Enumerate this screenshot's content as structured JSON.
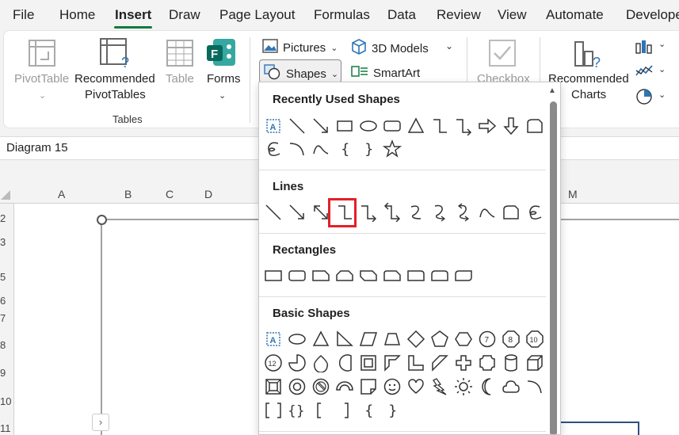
{
  "menu": {
    "tabs": [
      "File",
      "Home",
      "Insert",
      "Draw",
      "Page Layout",
      "Formulas",
      "Data",
      "Review",
      "View",
      "Automate",
      "Develope"
    ],
    "active_tab": "Insert"
  },
  "ribbon": {
    "pivot_table": "PivotTable",
    "recommended_pivot_1": "Recommended",
    "recommended_pivot_2": "PivotTables",
    "table": "Table",
    "forms": "Forms",
    "tables_group": "Tables",
    "pictures": "Pictures",
    "models_3d": "3D Models",
    "shapes": "Shapes",
    "smartart": "SmartArt",
    "checkbox": "Checkbox",
    "recommended_charts_1": "Recommended",
    "recommended_charts_2": "Charts"
  },
  "name_box": {
    "value": "Diagram 15"
  },
  "columns": [
    "A",
    "B",
    "C",
    "D",
    "M"
  ],
  "rows": [
    "2",
    "3",
    "5",
    "6",
    "7",
    "8",
    "9",
    "10",
    "11"
  ],
  "shapes_panel": {
    "sections": {
      "recent": "Recently Used Shapes",
      "lines": "Lines",
      "rectangles": "Rectangles",
      "basic": "Basic Shapes"
    },
    "highlighted_shape": "elbow-connector"
  },
  "colors": {
    "accent": "#107c41",
    "highlight": "#e32029",
    "icon_blue": "#2e75b6"
  }
}
